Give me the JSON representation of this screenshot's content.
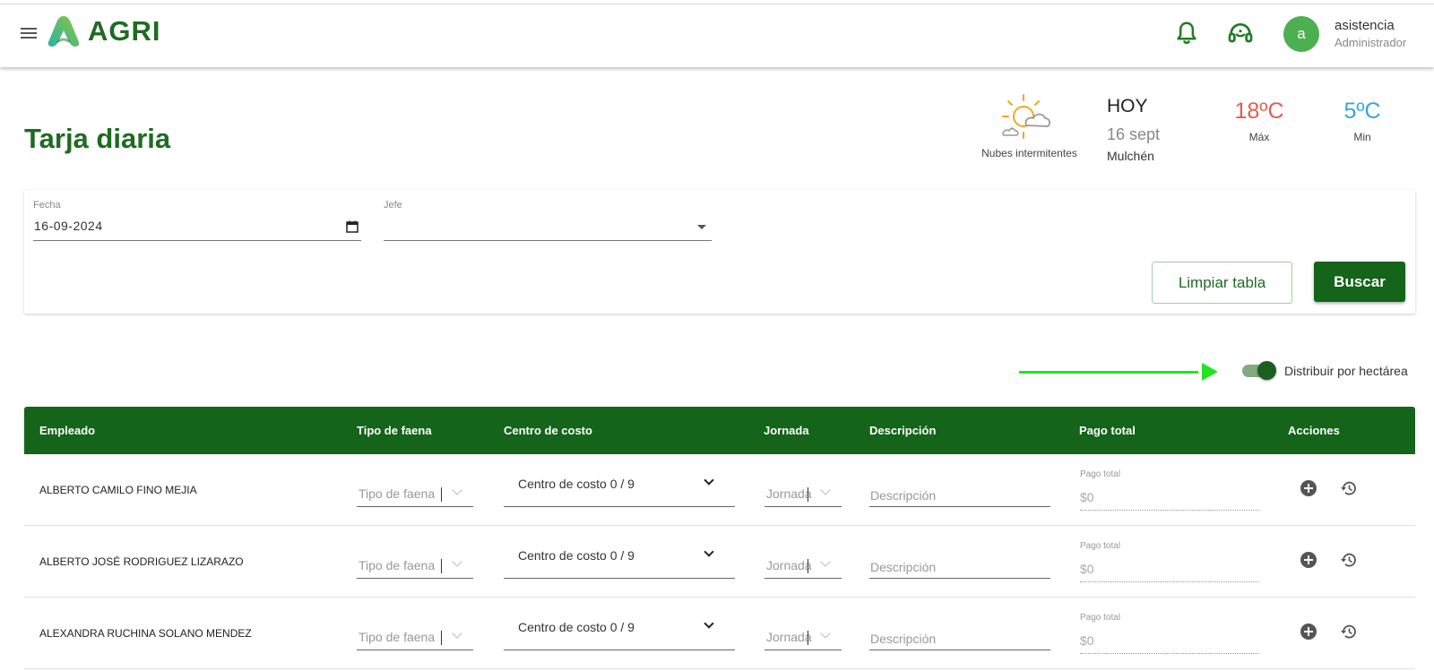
{
  "header": {
    "logo_text": "AGRI",
    "user_initial": "a",
    "user_name": "asistencia",
    "user_role": "Administrador"
  },
  "page": {
    "title": "Tarja diaria"
  },
  "weather": {
    "description": "Nubes intermitentes",
    "day_label": "HOY",
    "date": "16 sept",
    "location": "Mulchén",
    "max_temp": "18ºC",
    "max_label": "Máx",
    "min_temp": "5ºC",
    "min_label": "Min"
  },
  "filters": {
    "date_label": "Fecha",
    "date_value": "16-09-2024",
    "boss_label": "Jefe",
    "boss_value": "",
    "clear_label": "Limpiar tabla",
    "search_label": "Buscar"
  },
  "toggle": {
    "label": "Distribuir por hectárea",
    "on": true
  },
  "table": {
    "headers": [
      "Empleado",
      "Tipo de faena",
      "Centro de costo",
      "Jornada",
      "Descripción",
      "Pago total",
      "Acciones"
    ],
    "rows": [
      {
        "employee": "ALBERTO CAMILO FINO MEJIA",
        "task_type": "Tipo de faena",
        "cost_center": "Centro de costo 0 / 9",
        "shift": "Jornada",
        "description": "Descripción",
        "payment_label": "Pago total",
        "payment": "$0"
      },
      {
        "employee": "ALBERTO JOSÉ RODRIGUEZ LIZARAZO",
        "task_type": "Tipo de faena",
        "cost_center": "Centro de costo 0 / 9",
        "shift": "Jornada",
        "description": "Descripción",
        "payment_label": "Pago total",
        "payment": "$0"
      },
      {
        "employee": "ALEXANDRA RUCHINA SOLANO MENDEZ",
        "task_type": "Tipo de faena",
        "cost_center": "Centro de costo 0 / 9",
        "shift": "Jornada",
        "description": "Descripción",
        "payment_label": "Pago total",
        "payment": "$0"
      }
    ]
  },
  "colors": {
    "brand_green": "#14641a",
    "title_green": "#1e6b22",
    "max_temp": "#e65c4f",
    "min_temp": "#3aa3e0",
    "annotation_arrow": "#22e51d"
  },
  "icons": [
    "menu-icon",
    "logo-icon",
    "bell-icon",
    "support-headset-icon",
    "weather-partly-cloudy-icon",
    "calendar-icon",
    "dropdown-arrow-icon",
    "chevron-down-icon",
    "add-circle-icon",
    "history-icon"
  ]
}
